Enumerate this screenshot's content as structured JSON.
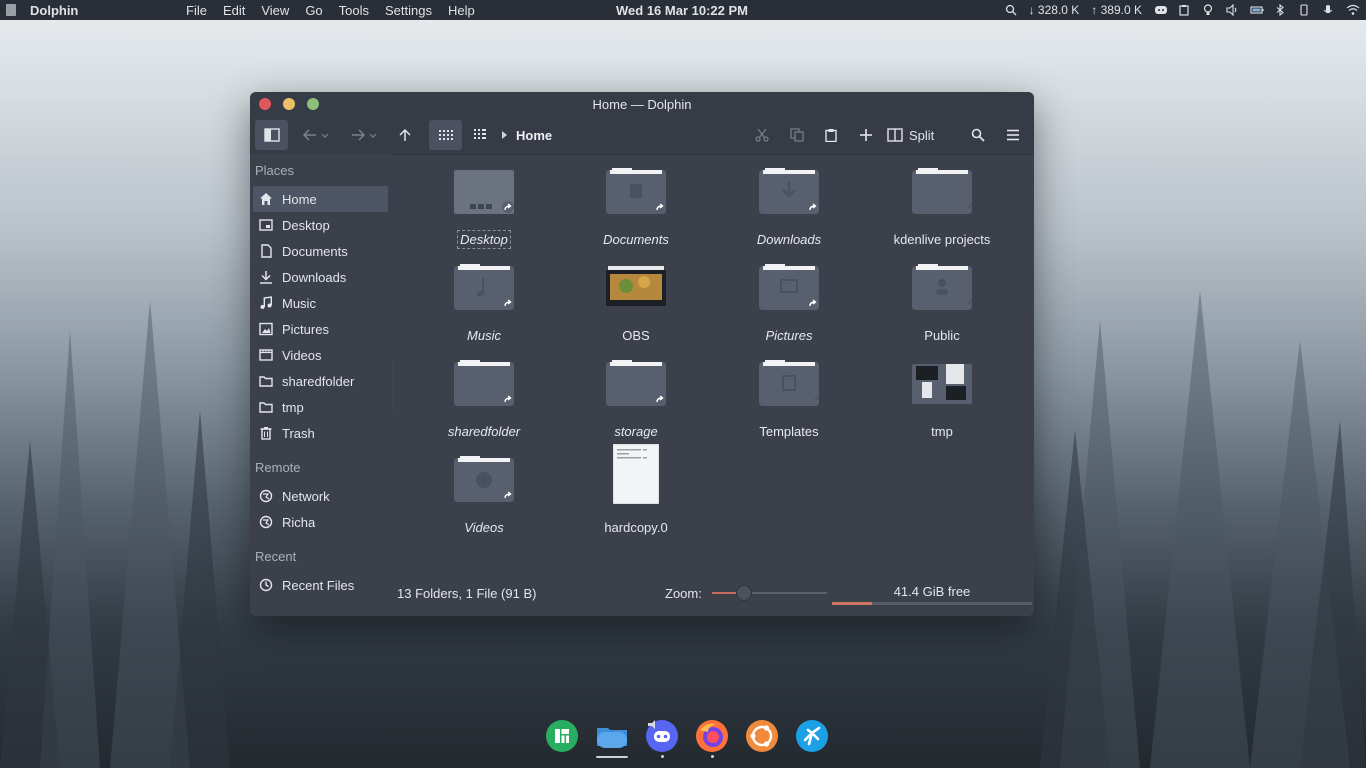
{
  "topbar": {
    "app_name": "Dolphin",
    "menu": [
      "File",
      "Edit",
      "View",
      "Go",
      "Tools",
      "Settings",
      "Help"
    ],
    "clock": "Wed 16 Mar  10:22 PM",
    "net_down": "↓ 328.0 K",
    "net_up": "↑ 389.0 K"
  },
  "window": {
    "title": "Home — Dolphin",
    "breadcrumb": "Home",
    "split_label": "Split"
  },
  "sidebar": {
    "places_header": "Places",
    "places": [
      {
        "label": "Home",
        "icon": "home-icon"
      },
      {
        "label": "Desktop",
        "icon": "desktop-icon"
      },
      {
        "label": "Documents",
        "icon": "document-icon"
      },
      {
        "label": "Downloads",
        "icon": "download-icon"
      },
      {
        "label": "Music",
        "icon": "music-icon"
      },
      {
        "label": "Pictures",
        "icon": "picture-icon"
      },
      {
        "label": "Videos",
        "icon": "video-icon"
      },
      {
        "label": "sharedfolder",
        "icon": "folder-icon"
      },
      {
        "label": "tmp",
        "icon": "folder-icon"
      },
      {
        "label": "Trash",
        "icon": "trash-icon"
      }
    ],
    "remote_header": "Remote",
    "remote": [
      {
        "label": "Network",
        "icon": "network-icon"
      },
      {
        "label": "Richa",
        "icon": "network-icon"
      }
    ],
    "recent_header": "Recent",
    "recent": [
      {
        "label": "Recent Files",
        "icon": "clock-icon"
      }
    ]
  },
  "files": [
    {
      "name": "Desktop",
      "italic": true,
      "type": "folder-desktop"
    },
    {
      "name": "Documents",
      "italic": true,
      "type": "folder-documents"
    },
    {
      "name": "Downloads",
      "italic": true,
      "type": "folder-downloads"
    },
    {
      "name": "kdenlive projects",
      "italic": false,
      "type": "folder"
    },
    {
      "name": "Music",
      "italic": true,
      "type": "folder-music"
    },
    {
      "name": "OBS",
      "italic": false,
      "type": "folder-obs"
    },
    {
      "name": "Pictures",
      "italic": true,
      "type": "folder-pictures"
    },
    {
      "name": "Public",
      "italic": false,
      "type": "folder-public"
    },
    {
      "name": "sharedfolder",
      "italic": true,
      "type": "folder"
    },
    {
      "name": "storage",
      "italic": true,
      "type": "folder"
    },
    {
      "name": "Templates",
      "italic": false,
      "type": "folder-templates"
    },
    {
      "name": "tmp",
      "italic": false,
      "type": "folder-tmp"
    },
    {
      "name": "Videos",
      "italic": true,
      "type": "folder-videos"
    },
    {
      "name": "hardcopy.0",
      "italic": false,
      "type": "text-file"
    }
  ],
  "status": {
    "summary": "13 Folders, 1 File (91 B)",
    "zoom_label": "Zoom:",
    "zoom_level": 0.27,
    "free_space": "41.4 GiB free",
    "used_fraction": 0.2
  },
  "colors": {
    "window_bg": "#3b404b",
    "titlebar_bg": "#363b45",
    "accent": "#d07562",
    "folder_body": "#586070"
  },
  "dock": [
    "manjaro-settings-icon",
    "dolphin-icon",
    "discord-icon",
    "firefox-icon",
    "ubuntu-icon",
    "kdeconnect-icon"
  ]
}
